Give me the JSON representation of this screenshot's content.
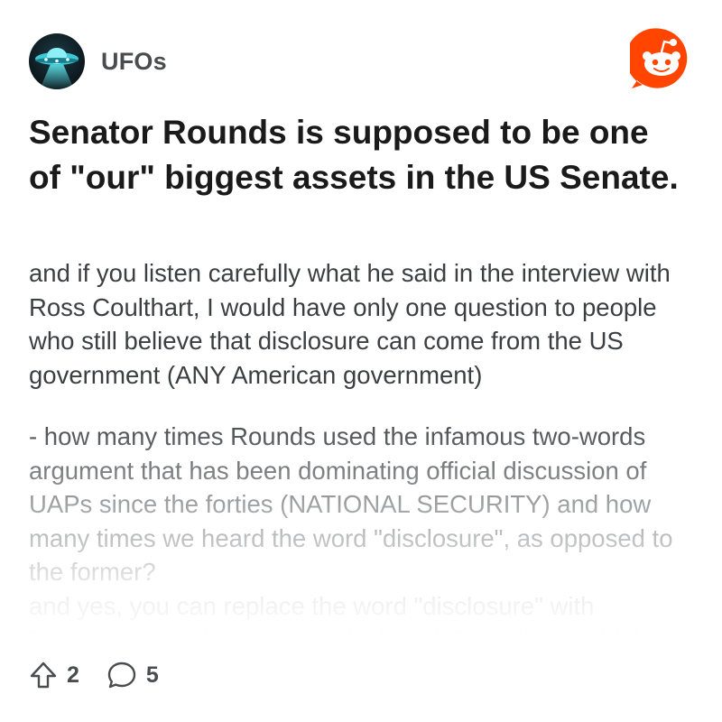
{
  "subreddit": {
    "name": "UFOs"
  },
  "post": {
    "title": "Senator Rounds is supposed to be one of \"our\" biggest assets in the US Senate.",
    "body": [
      "and if you listen carefully what he said in the interview with Ross Coulthart, I would have only one question to people who still believe that disclosure can come from the US government (ANY American government)",
      "- how many times Rounds used the infamous two-words argument that has been dominating official discussion of UAPs since the forties (NATIONAL SECURITY) and how many times we heard the word \"disclosure\", as opposed to the former?\nand yes, you can replace the word \"disclosure\" with \"transparency\", \"openness\", \"right to information\". I think"
    ]
  },
  "stats": {
    "upvotes": "2",
    "comments": "5"
  },
  "icons": {
    "avatar": "ufo-avatar-icon",
    "brand": "reddit-logo-icon",
    "upvote": "upvote-arrow-icon",
    "comment": "comment-bubble-icon"
  },
  "colors": {
    "reddit_orange": "#ff4500",
    "text_primary": "#1a1a1b",
    "text_body": "#3c3f42",
    "text_muted": "#4a4d50"
  }
}
